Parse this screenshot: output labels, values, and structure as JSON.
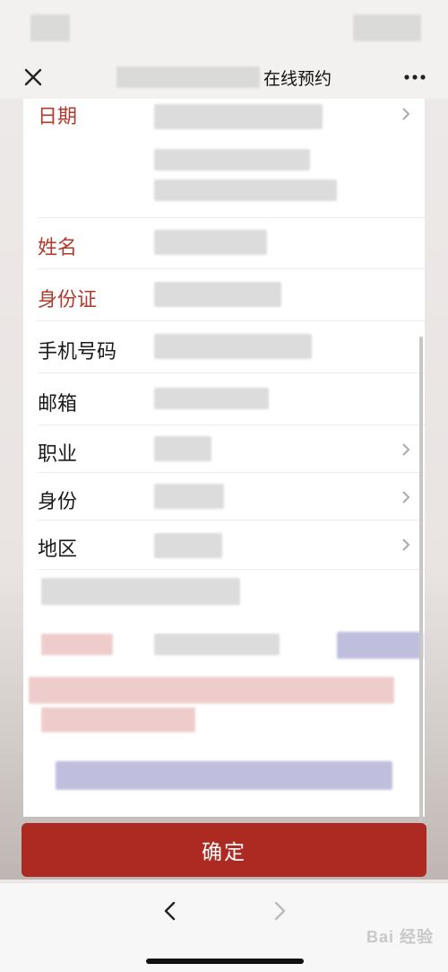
{
  "nav": {
    "title": "在线预约",
    "close_icon": "close-icon",
    "more_icon": "more-icon"
  },
  "form": {
    "fields": [
      {
        "label": "日期",
        "required": true
      },
      {
        "label": "姓名",
        "required": true
      },
      {
        "label": "身份证",
        "required": true
      },
      {
        "label": "手机号码",
        "required": false
      },
      {
        "label": "邮箱",
        "required": false
      },
      {
        "label": "职业",
        "required": false
      },
      {
        "label": "身份",
        "required": false
      },
      {
        "label": "地区",
        "required": false
      }
    ]
  },
  "confirm_label": "确定",
  "toolbar": {
    "back_icon": "chevron-left-icon",
    "forward_icon": "chevron-right-icon"
  },
  "watermark": "Bai 经验",
  "colors": {
    "accent": "#ad2a22",
    "required_label": "#b23a2e"
  }
}
